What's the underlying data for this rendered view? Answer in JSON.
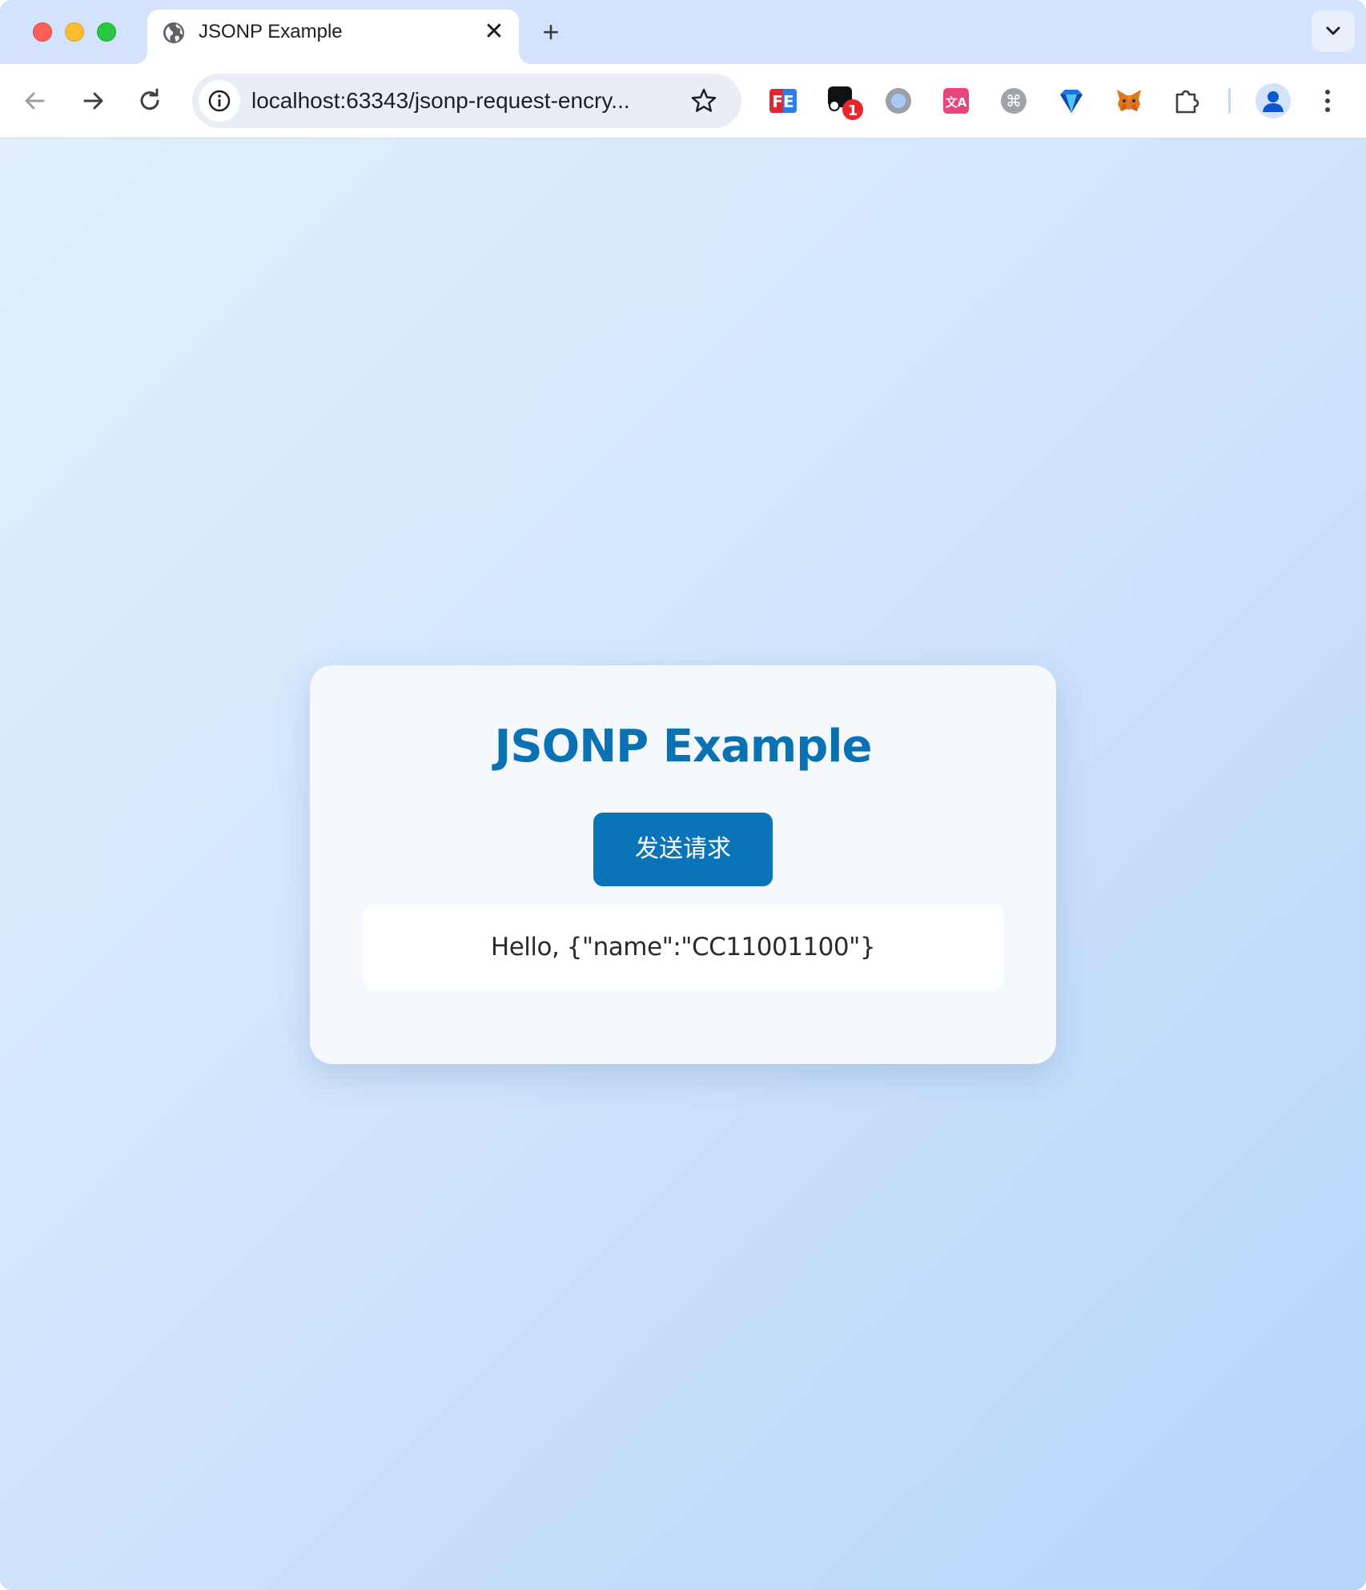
{
  "browser": {
    "tab": {
      "title": "JSONP Example",
      "close_glyph": "✕"
    },
    "new_tab_glyph": "+",
    "address_bar": {
      "url": "localhost:63343/jsonp-request-encry..."
    },
    "extensions": [
      {
        "name": "fehelper-extension-icon",
        "label": "FE"
      },
      {
        "name": "notification-extension-icon",
        "badge": "1"
      },
      {
        "name": "circle-extension-icon"
      },
      {
        "name": "translate-extension-icon",
        "label": "文A"
      },
      {
        "name": "command-extension-icon",
        "label": "⌘"
      },
      {
        "name": "diamond-extension-icon"
      },
      {
        "name": "metamask-fox-icon"
      },
      {
        "name": "extensions-puzzle-icon"
      }
    ],
    "colors": {
      "tabstrip": "#d3e3fd",
      "accent": "#0b73b8"
    }
  },
  "page": {
    "title": "JSONP Example",
    "send_button_label": "发送请求",
    "result_text": "Hello, {\"name\":\"CC11001100\"}"
  }
}
